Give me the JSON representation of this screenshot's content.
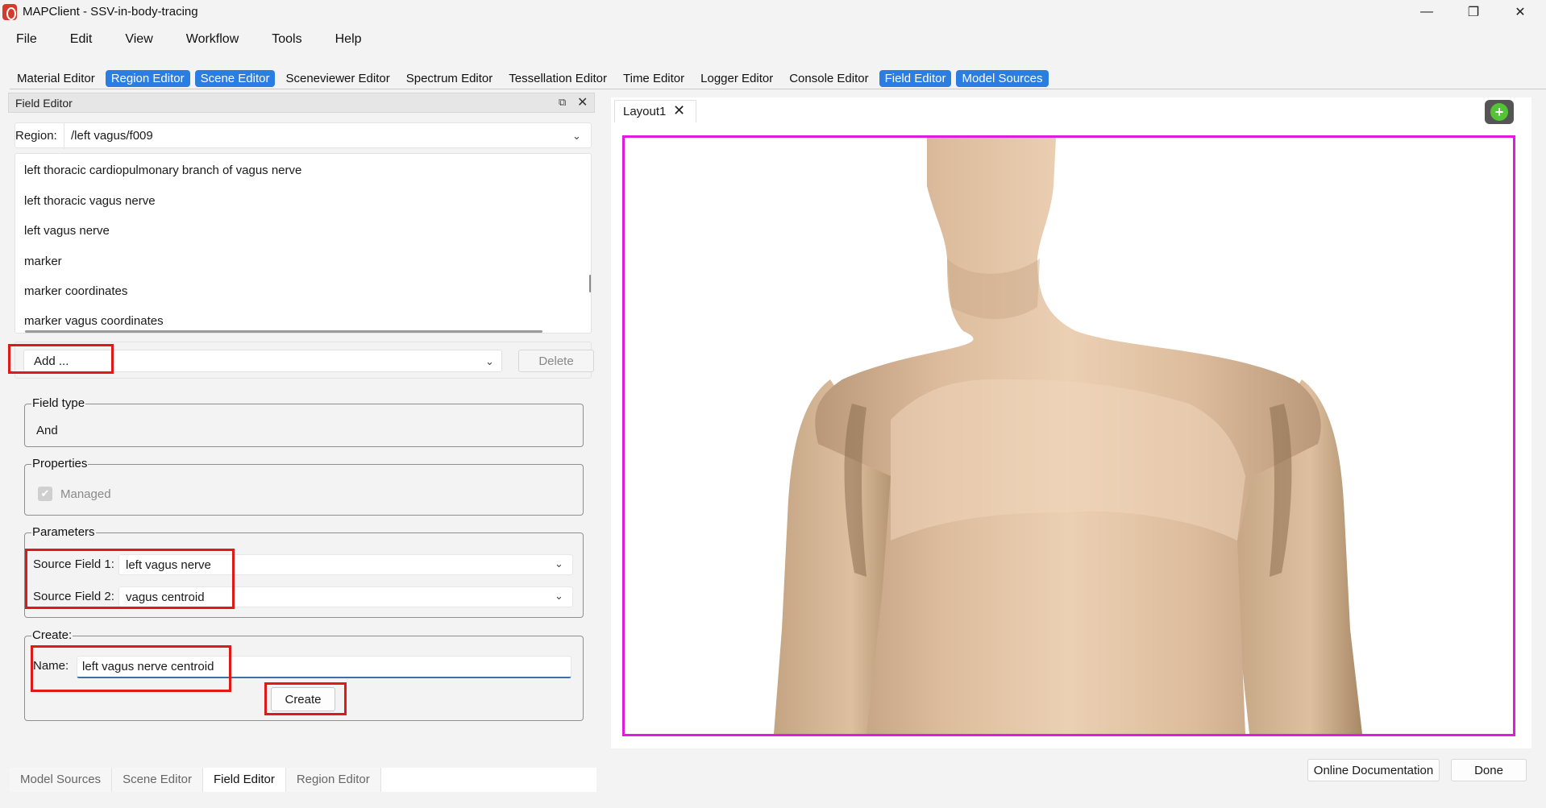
{
  "window": {
    "title": "MAPClient - SSV-in-body-tracing",
    "controls": [
      "minimize",
      "restore",
      "close"
    ]
  },
  "menu": [
    "File",
    "Edit",
    "View",
    "Workflow",
    "Tools",
    "Help"
  ],
  "editor_toolbar": [
    {
      "label": "Material Editor",
      "active": false
    },
    {
      "label": "Region Editor",
      "active": true
    },
    {
      "label": "Scene Editor",
      "active": true
    },
    {
      "label": "Sceneviewer Editor",
      "active": false
    },
    {
      "label": "Spectrum Editor",
      "active": false
    },
    {
      "label": "Tessellation Editor",
      "active": false
    },
    {
      "label": "Time Editor",
      "active": false
    },
    {
      "label": "Logger Editor",
      "active": false
    },
    {
      "label": "Console Editor",
      "active": false
    },
    {
      "label": "Field Editor",
      "active": true
    },
    {
      "label": "Model Sources",
      "active": true
    }
  ],
  "field_editor": {
    "dock_title": "Field Editor",
    "region_label": "Region:",
    "region_value": "/left vagus/f009",
    "field_list": [
      "left thoracic cardiopulmonary branch of vagus nerve",
      "left thoracic vagus nerve",
      "left vagus nerve",
      "marker",
      "marker coordinates",
      "marker vagus coordinates"
    ],
    "add_label": "Add ...",
    "delete_label": "Delete",
    "field_type": {
      "title": "Field type",
      "value": "And"
    },
    "properties": {
      "title": "Properties",
      "managed_label": "Managed",
      "managed_checked": true
    },
    "parameters": {
      "title": "Parameters",
      "source1_label": "Source Field 1:",
      "source1_value": "left vagus nerve",
      "source2_label": "Source Field 2:",
      "source2_value": "vagus centroid"
    },
    "create": {
      "title": "Create:",
      "name_label": "Name:",
      "name_value": "left vagus nerve centroid",
      "button_label": "Create"
    }
  },
  "bottom_tabs": [
    {
      "label": "Model Sources",
      "active": false
    },
    {
      "label": "Scene Editor",
      "active": false
    },
    {
      "label": "Field Editor",
      "active": true
    },
    {
      "label": "Region Editor",
      "active": false
    }
  ],
  "layout": {
    "tab_label": "Layout1",
    "add_icon": "plus-circle-icon"
  },
  "footer": {
    "online_doc_label": "Online Documentation",
    "done_label": "Done"
  },
  "colors": {
    "accent": "#2a7de1",
    "highlight": "#e01818",
    "viewport_border": "#e21ae0",
    "skin": "#e8c8a6"
  }
}
